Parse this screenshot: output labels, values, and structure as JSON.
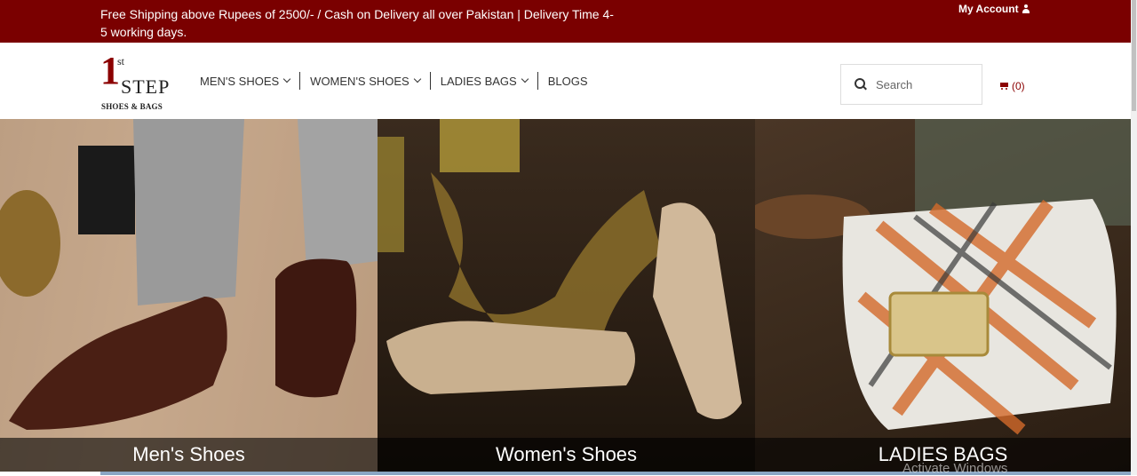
{
  "topbar": {
    "promo": "Free Shipping above Rupees of 2500/- / Cash on Delivery all over Pakistan | Delivery Time 4-5 working days.",
    "account_label": "My Account"
  },
  "logo": {
    "one": "1",
    "st": "st",
    "step": "STEP",
    "sub": "SHOES & BAGS"
  },
  "nav": {
    "items": [
      {
        "label": "MEN'S SHOES"
      },
      {
        "label": "WOMEN'S SHOES"
      },
      {
        "label": "LADIES BAGS"
      },
      {
        "label": "BLOGS"
      }
    ]
  },
  "search": {
    "placeholder": "Search"
  },
  "cart": {
    "count_label": "(0)"
  },
  "hero": {
    "tiles": [
      {
        "caption": "Men's Shoes"
      },
      {
        "caption": "Women's Shoes"
      },
      {
        "caption": "LADIES BAGS"
      }
    ]
  },
  "watermark": "Activate Windows",
  "colors": {
    "brand": "#7a0000",
    "accent": "#8b0000"
  },
  "icons": [
    "user-icon",
    "chevron-down-icon",
    "search-icon",
    "cart-icon"
  ]
}
